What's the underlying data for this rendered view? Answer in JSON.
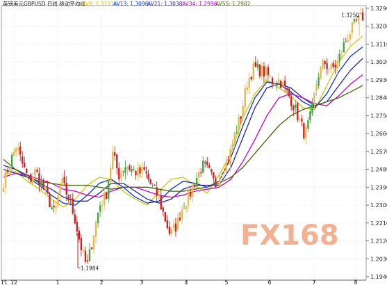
{
  "chart_data": {
    "type": "candlestick",
    "title": "英镑美元GBPUSD 日线 移动平均线",
    "legend": [
      {
        "label": "AV8: 1.3151",
        "color": "#d8c400",
        "series": "AV8"
      },
      {
        "label": "AV13: 1.3096",
        "color": "#0033dd",
        "series": "AV13"
      },
      {
        "label": "AV21: 1.3038",
        "color": "#2222aa",
        "series": "AV21"
      },
      {
        "label": "AV34: 1.2956",
        "color": "#cc00cc",
        "series": "AV34"
      },
      {
        "label": "AV55: 1.2902",
        "color": "#446600",
        "series": "AV55"
      }
    ],
    "y_ticks": [
      "1.3290",
      "1.3200",
      "1.3110",
      "1.3020",
      "1.2930",
      "1.2840",
      "1.2750",
      "1.2660",
      "1.2570",
      "1.2480",
      "1.2390",
      "1.2300",
      "1.2210",
      "1.2120",
      "1.2030",
      "1.1940"
    ],
    "x_ticks": [
      "11",
      "12",
      "1",
      "2",
      "3",
      "4",
      "5",
      "6",
      "7",
      "8"
    ],
    "ylim": [
      1.194,
      1.329
    ],
    "annotations": [
      {
        "label": "1.3250",
        "value": 1.325
      },
      {
        "label": "1.1984",
        "value": 1.1984
      }
    ],
    "watermark": "FX168",
    "up_color": "#e8b84a",
    "up_dark_color": "#3aa83a",
    "down_color": "#cc2222",
    "price_path": [
      1.242,
      1.251,
      1.26,
      1.25,
      1.242,
      1.247,
      1.24,
      1.233,
      1.225,
      1.242,
      1.235,
      1.225,
      1.21,
      1.1984,
      1.215,
      1.23,
      1.235,
      1.256,
      1.245,
      1.25,
      1.248,
      1.246,
      1.247,
      1.24,
      1.235,
      1.225,
      1.215,
      1.22,
      1.23,
      1.235,
      1.243,
      1.25,
      1.247,
      1.24,
      1.248,
      1.252,
      1.265,
      1.275,
      1.292,
      1.299,
      1.298,
      1.296,
      1.292,
      1.293,
      1.288,
      1.282,
      1.274,
      1.265,
      1.276,
      1.295,
      1.302,
      1.298,
      1.301,
      1.31,
      1.317,
      1.322,
      1.325
    ],
    "ma": {
      "AV8": [
        1.245,
        1.247,
        1.242,
        1.238,
        1.233,
        1.229,
        1.233,
        1.24,
        1.244,
        1.243,
        1.237,
        1.233,
        1.23,
        1.237,
        1.243,
        1.244,
        1.24,
        1.236,
        1.245,
        1.256,
        1.274,
        1.286,
        1.293,
        1.289,
        1.285,
        1.279,
        1.278,
        1.29,
        1.302,
        1.31,
        1.3151
      ],
      "AV13": [
        1.248,
        1.246,
        1.244,
        1.24,
        1.235,
        1.231,
        1.23,
        1.235,
        1.241,
        1.243,
        1.239,
        1.234,
        1.231,
        1.232,
        1.238,
        1.242,
        1.241,
        1.239,
        1.242,
        1.254,
        1.27,
        1.284,
        1.292,
        1.291,
        1.287,
        1.282,
        1.279,
        1.286,
        1.297,
        1.305,
        1.3096
      ],
      "AV21": [
        1.25,
        1.248,
        1.245,
        1.241,
        1.238,
        1.234,
        1.232,
        1.232,
        1.236,
        1.241,
        1.241,
        1.237,
        1.233,
        1.231,
        1.233,
        1.238,
        1.24,
        1.24,
        1.24,
        1.249,
        1.264,
        1.279,
        1.289,
        1.291,
        1.289,
        1.284,
        1.28,
        1.282,
        1.29,
        1.298,
        1.3038
      ],
      "AV34": [
        1.244,
        1.246,
        1.245,
        1.243,
        1.241,
        1.238,
        1.237,
        1.235,
        1.234,
        1.237,
        1.239,
        1.239,
        1.237,
        1.235,
        1.234,
        1.235,
        1.237,
        1.238,
        1.239,
        1.243,
        1.252,
        1.263,
        1.275,
        1.284,
        1.286,
        1.284,
        1.281,
        1.28,
        1.285,
        1.291,
        1.2956
      ],
      "AV55": [
        1.253,
        1.248,
        1.244,
        1.242,
        1.241,
        1.24,
        1.24,
        1.24,
        1.239,
        1.238,
        1.239,
        1.239,
        1.239,
        1.238,
        1.237,
        1.237,
        1.238,
        1.239,
        1.241,
        1.244,
        1.249,
        1.256,
        1.263,
        1.27,
        1.275,
        1.278,
        1.28,
        1.282,
        1.284,
        1.287,
        1.2902
      ]
    }
  }
}
